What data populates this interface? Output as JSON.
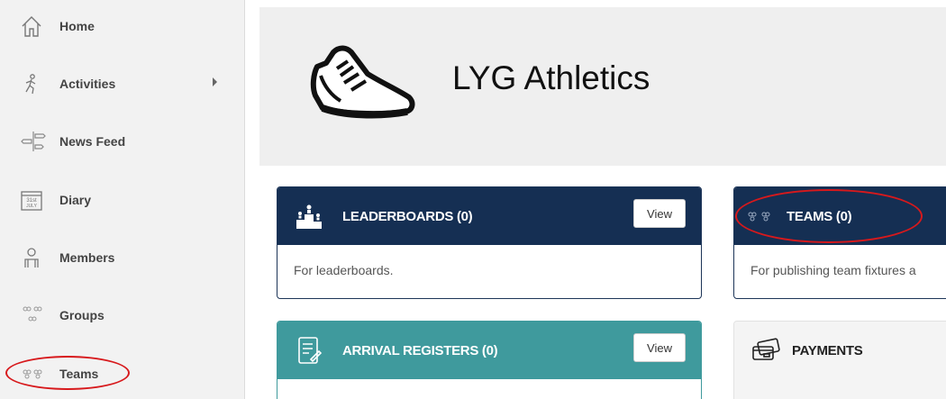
{
  "sidebar": {
    "items": [
      {
        "label": "Home",
        "icon": "home-icon"
      },
      {
        "label": "Activities",
        "icon": "running-person-icon",
        "has_submenu": true
      },
      {
        "label": "News Feed",
        "icon": "signpost-icon"
      },
      {
        "label": "Diary",
        "icon": "calendar-icon",
        "icon_text_1": "31st",
        "icon_text_2": "JULY"
      },
      {
        "label": "Members",
        "icon": "person-icon"
      },
      {
        "label": "Groups",
        "icon": "groups-icon"
      },
      {
        "label": "Teams",
        "icon": "teams-icon"
      }
    ]
  },
  "hero": {
    "title": "LYG Athletics",
    "logo": "running-shoe-icon"
  },
  "cards": {
    "leaderboards": {
      "title": "LEADERBOARDS (0)",
      "button": "View",
      "description": "For leaderboards.",
      "icon": "podium-icon"
    },
    "teams": {
      "title": "TEAMS (0)",
      "description": "For publishing team fixtures a",
      "icon": "teams-icon"
    },
    "arrival": {
      "title": "ARRIVAL REGISTERS (0)",
      "button": "View",
      "icon": "register-icon"
    },
    "payments": {
      "title": "PAYMENTS",
      "icon": "credit-card-icon"
    }
  },
  "colors": {
    "navy": "#152f53",
    "teal": "#3f9a9d",
    "highlight": "#d7191c"
  }
}
